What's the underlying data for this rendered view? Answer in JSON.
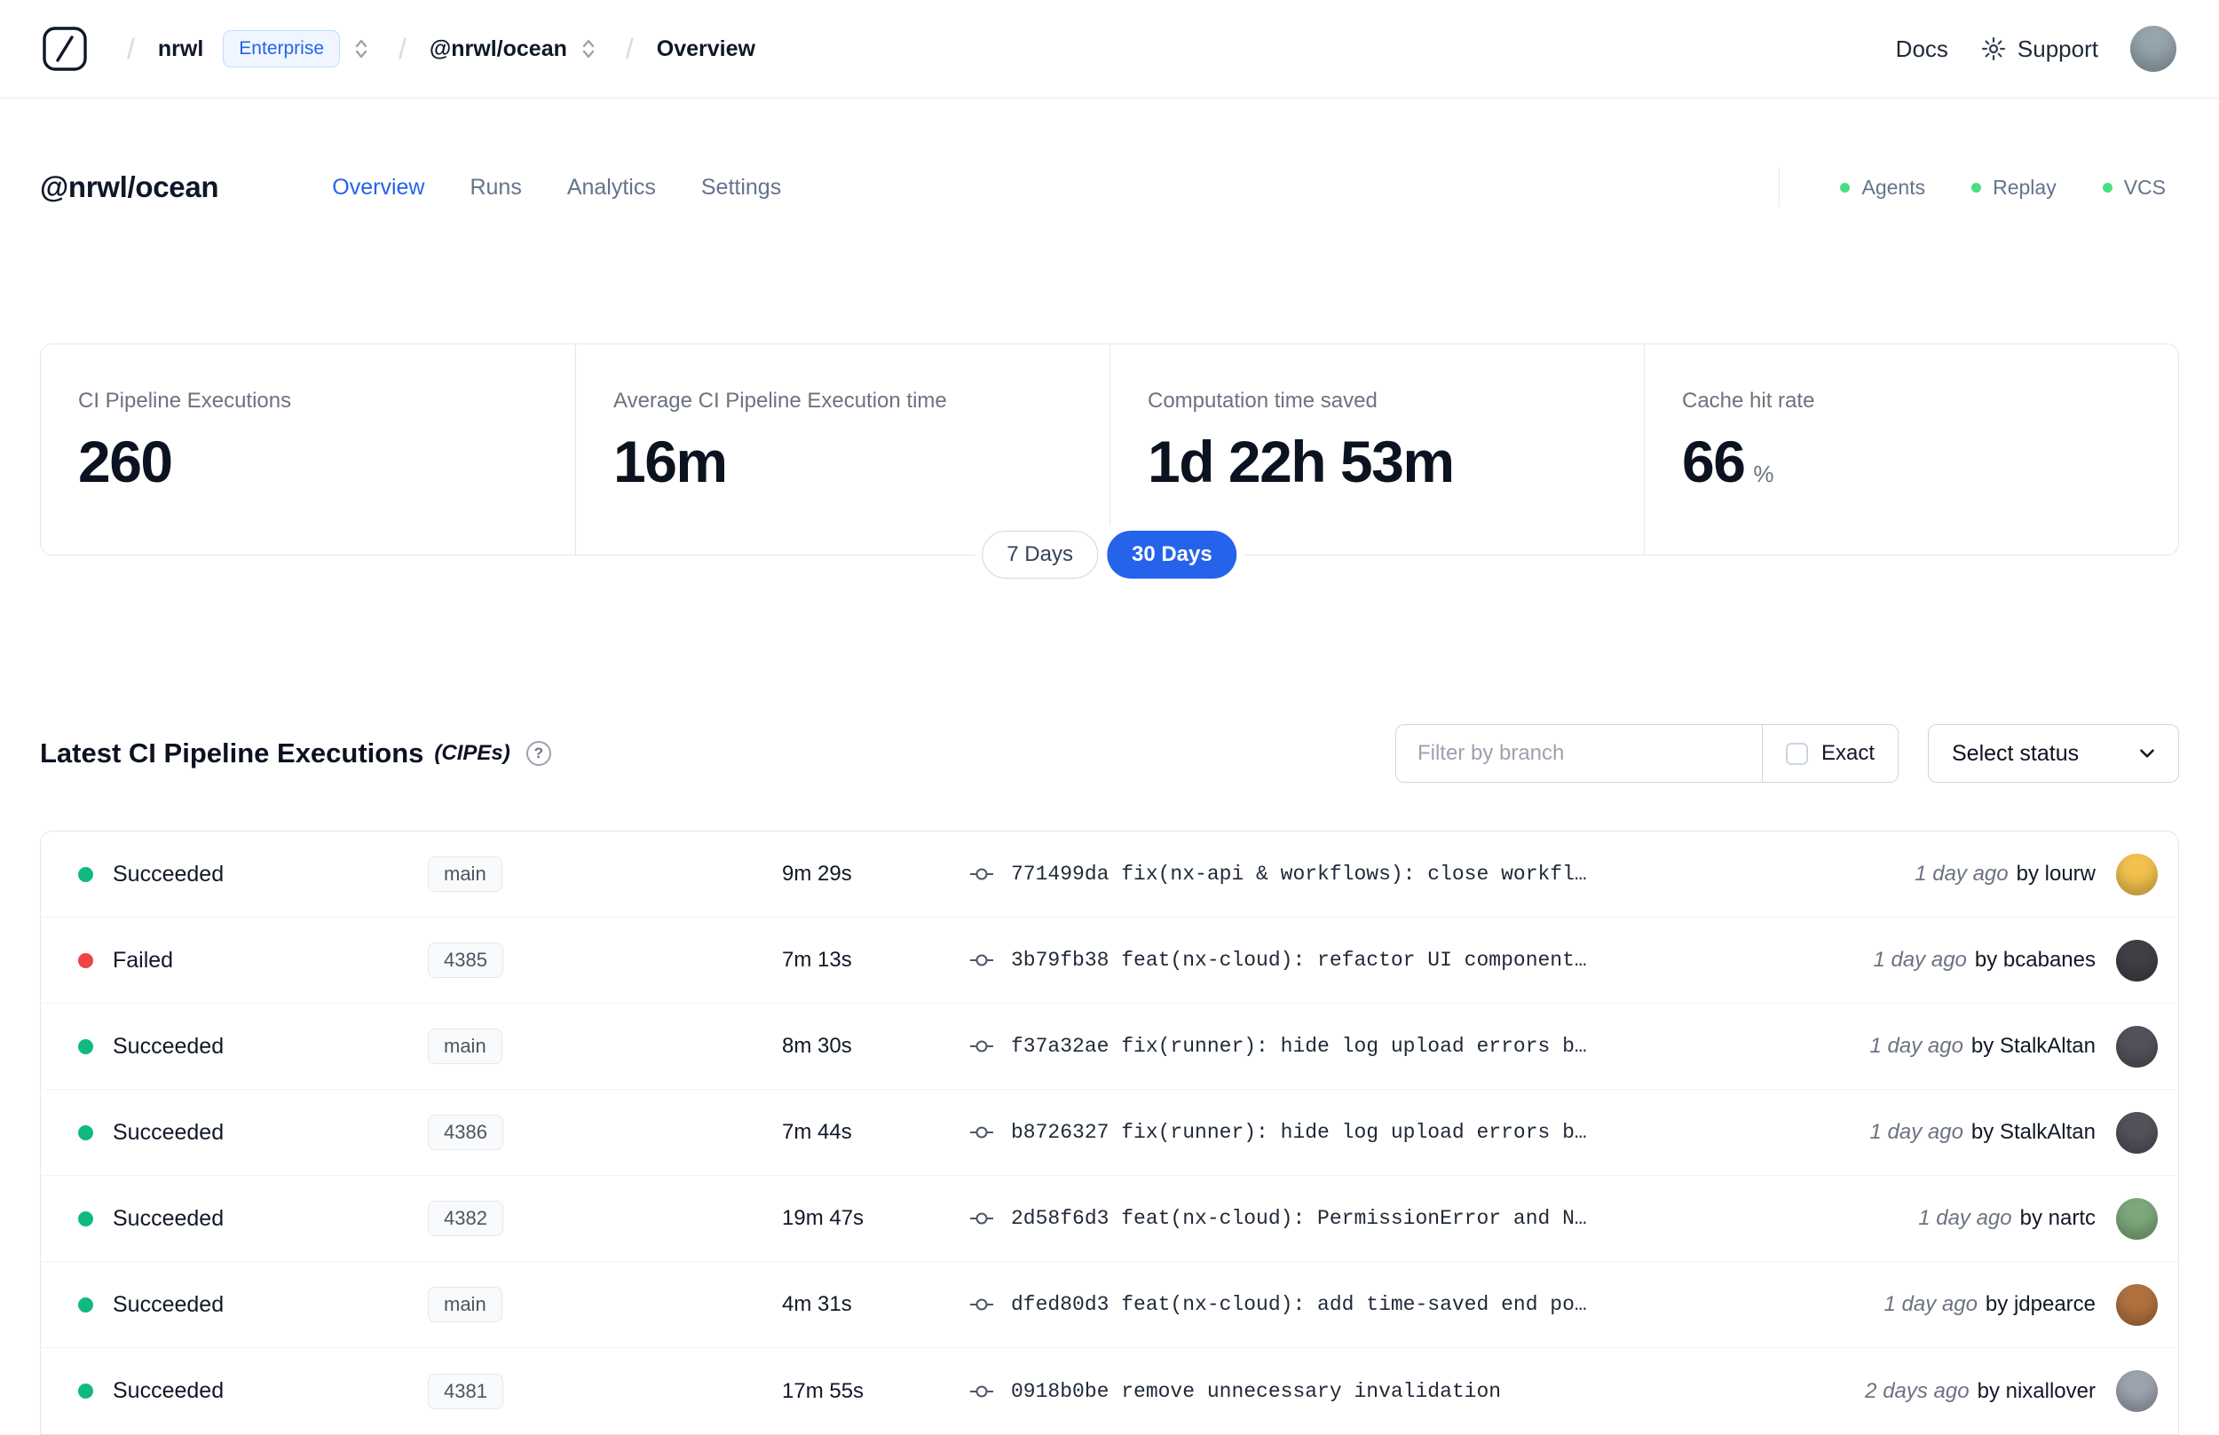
{
  "colors": {
    "accent": "#2563eb",
    "success": "#10b981",
    "danger": "#ef4444",
    "indicator_green": "#4ade80"
  },
  "header": {
    "breadcrumb": {
      "org": "nrwl",
      "org_badge": "Enterprise",
      "workspace": "@nrwl/ocean",
      "page": "Overview"
    },
    "docs_label": "Docs",
    "support_label": "Support",
    "avatar_color": "#97a6ae"
  },
  "workspace": {
    "title": "@nrwl/ocean",
    "tabs": [
      {
        "label": "Overview"
      },
      {
        "label": "Runs"
      },
      {
        "label": "Analytics"
      },
      {
        "label": "Settings"
      }
    ],
    "active_tab": "Overview",
    "indicators": [
      {
        "label": "Agents"
      },
      {
        "label": "Replay"
      },
      {
        "label": "VCS"
      }
    ]
  },
  "metrics": {
    "cards": [
      {
        "label": "CI Pipeline Executions",
        "value": "260"
      },
      {
        "label": "Average CI Pipeline Execution time",
        "value": "16m"
      },
      {
        "label": "Computation time saved",
        "value": "1d 22h 53m"
      },
      {
        "label": "Cache hit rate",
        "value": "66",
        "unit": "%"
      }
    ],
    "range": {
      "options": [
        {
          "label": "7 Days"
        },
        {
          "label": "30 Days"
        }
      ],
      "selected": "30 Days"
    }
  },
  "cipes": {
    "title": "Latest CI Pipeline Executions",
    "suffix": "(CIPEs)",
    "help_icon": "?",
    "filter_placeholder": "Filter by branch",
    "exact_label": "Exact",
    "status_select_label": "Select status",
    "rows": [
      {
        "status": "Succeeded",
        "status_color": "#10b981",
        "branch": "main",
        "duration": "9m 29s",
        "commit": "771499da fix(nx-api & workflows): close workfl…",
        "ago": "1 day ago",
        "author": "by lourw",
        "avatar_color": "#f2c14e"
      },
      {
        "status": "Failed",
        "status_color": "#ef4444",
        "branch": "4385",
        "duration": "7m 13s",
        "commit": "3b79fb38 feat(nx-cloud): refactor UI component…",
        "ago": "1 day ago",
        "author": "by bcabanes",
        "avatar_color": "#3f3f46"
      },
      {
        "status": "Succeeded",
        "status_color": "#10b981",
        "branch": "main",
        "duration": "8m 30s",
        "commit": "f37a32ae fix(runner): hide log upload errors b…",
        "ago": "1 day ago",
        "author": "by StalkAltan",
        "avatar_color": "#52525b"
      },
      {
        "status": "Succeeded",
        "status_color": "#10b981",
        "branch": "4386",
        "duration": "7m 44s",
        "commit": "b8726327 fix(runner): hide log upload errors b…",
        "ago": "1 day ago",
        "author": "by StalkAltan",
        "avatar_color": "#52525b"
      },
      {
        "status": "Succeeded",
        "status_color": "#10b981",
        "branch": "4382",
        "duration": "19m 47s",
        "commit": "2d58f6d3 feat(nx-cloud): PermissionError and N…",
        "ago": "1 day ago",
        "author": "by nartc",
        "avatar_color": "#7da87b"
      },
      {
        "status": "Succeeded",
        "status_color": "#10b981",
        "branch": "main",
        "duration": "4m 31s",
        "commit": "dfed80d3 feat(nx-cloud): add time-saved end po…",
        "ago": "1 day ago",
        "author": "by jdpearce",
        "avatar_color": "#b0713f"
      },
      {
        "status": "Succeeded",
        "status_color": "#10b981",
        "branch": "4381",
        "duration": "17m 55s",
        "commit": "0918b0be remove unnecessary invalidation",
        "ago": "2 days ago",
        "author": "by nixallover",
        "avatar_color": "#9ca3af"
      }
    ]
  }
}
